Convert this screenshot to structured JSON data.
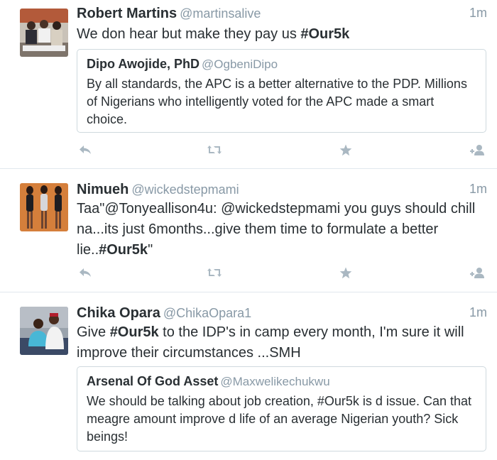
{
  "tweets": [
    {
      "name": "Robert Martins",
      "handle": "@martinsalive",
      "time": "1m",
      "text_pre": "We don hear but make they pay us ",
      "hashtag": "#Our5k",
      "text_post": "",
      "quote": {
        "name": "Dipo Awojide, PhD",
        "handle": "@OgbeniDipo",
        "text": "By all standards, the APC is a better alternative to the PDP. Millions of Nigerians who intelligently voted for the APC made a smart choice."
      }
    },
    {
      "name": "Nimueh",
      "handle": "@wickedstepmami",
      "time": "1m",
      "text_pre": "Taa\"@Tonyeallison4u: @wickedstepmami you guys should chill na...its just 6months...give them time to formulate a better lie..",
      "hashtag": "#Our5k",
      "text_post": "\""
    },
    {
      "name": "Chika Opara",
      "handle": "@ChikaOpara1",
      "time": "1m",
      "text_pre": "Give ",
      "hashtag": "#Our5k",
      "text_post": " to the IDP's in camp every month, I'm sure it will improve their circumstances ...SMH",
      "quote": {
        "name": "Arsenal Of God Asset",
        "handle": "@Maxwelikechukwu",
        "text": "We should be talking about job creation, #Our5k is d issue. Can that meagre amount improve d life of an average Nigerian youth? Sick beings!"
      }
    }
  ],
  "colors": {
    "text": "#292f33",
    "muted": "#8899a6",
    "icon": "#aab8c2",
    "border": "#e1e8ed"
  },
  "icons": {
    "reply": "reply-icon",
    "retweet": "retweet-icon",
    "favorite": "star-icon",
    "follow": "follow-icon"
  }
}
